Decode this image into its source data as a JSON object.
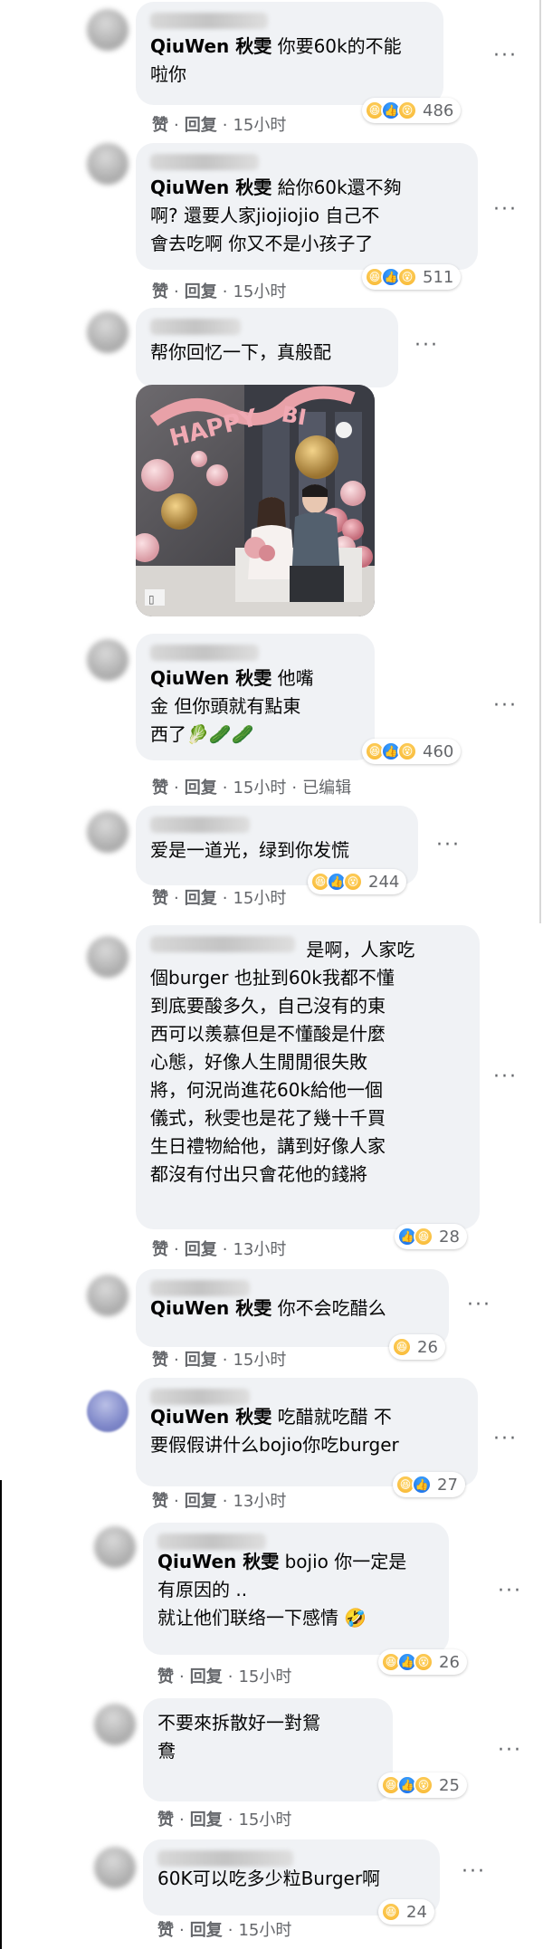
{
  "labels": {
    "like": "赞",
    "reply": "回复",
    "edited": "已编辑",
    "dot": "·",
    "more": "···"
  },
  "comments": [
    {
      "mention": "QiuWen 秋雯",
      "text": " 你要60k的不能\n啦你",
      "count": "486",
      "time": "15小时",
      "reactions": [
        "haha",
        "like",
        "wow"
      ]
    },
    {
      "mention": "QiuWen 秋雯",
      "text": " 給你60k還不夠\n啊? 還要人家jiojiojio 自己不\n會去吃啊 你又不是小孩子了",
      "count": "511",
      "time": "15小时",
      "reactions": [
        "haha",
        "like",
        "wow"
      ]
    },
    {
      "mention": "",
      "text": "帮你回忆一下，真般配",
      "count": "",
      "time": "",
      "reactions": []
    },
    {
      "mention": "QiuWen 秋雯",
      "text": " 他嘴\n金 但你頭就有點東\n西了🥬🥒🥒",
      "count": "460",
      "time": "15小时",
      "edited": true,
      "reactions": [
        "haha",
        "like",
        "wow"
      ]
    },
    {
      "mention": "",
      "text": "爱是一道光，绿到你发慌",
      "count": "244",
      "time": "15小时",
      "reactions": [
        "haha",
        "like",
        "wow"
      ]
    },
    {
      "mention": "",
      "text": " 是啊，人家吃\n個burger 也扯到60k我都不懂\n到底要酸多久，自己沒有的東\n西可以羨慕但是不懂酸是什麼\n心態，好像人生閒閒很失敗\n將，何況尚進花60k給他一個\n儀式，秋雯也是花了幾十千買\n生日禮物給他，講到好像人家\n都沒有付出只會花他的錢將",
      "count": "28",
      "time": "13小时",
      "reactions": [
        "like",
        "haha"
      ]
    },
    {
      "mention": "QiuWen 秋雯",
      "text": " 你不会吃醋么",
      "count": "26",
      "time": "15小时",
      "reactions": [
        "haha"
      ]
    },
    {
      "mention": "QiuWen 秋雯",
      "text": " 吃醋就吃醋 不\n要假假讲什么bojio你吃burger",
      "count": "27",
      "time": "13小时",
      "reactions": [
        "haha",
        "like"
      ]
    },
    {
      "mention": "QiuWen 秋雯",
      "text": " bojio 你一定是\n有原因的 ..\n就让他们联络一下感情 🤣",
      "count": "26",
      "time": "15小时",
      "reactions": [
        "haha",
        "like",
        "wow"
      ]
    },
    {
      "mention": "",
      "text": "不要來拆散好一對鴛\n鴦",
      "count": "25",
      "time": "15小时",
      "reactions": [
        "haha",
        "like",
        "wow"
      ]
    },
    {
      "mention": "",
      "text": "60K可以吃多少粒Burger啊",
      "count": "24",
      "time": "15小时",
      "reactions": [
        "haha"
      ]
    }
  ],
  "photo": {
    "balloon_text": "HAPPY BIRTHDAY"
  },
  "colors": {
    "bubble": "#f0f2f5",
    "meta": "#65676b",
    "text": "#050505",
    "like": "#1877f2",
    "haha": "#f7b125"
  }
}
